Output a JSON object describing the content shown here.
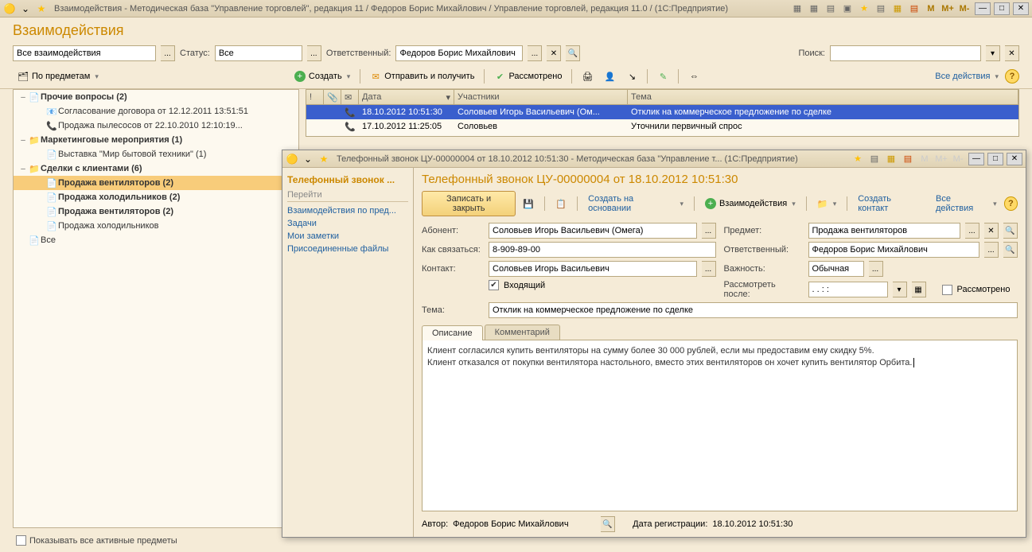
{
  "app": {
    "title": "Взаимодействия - Методическая база \"Управление торговлей\", редакция 11 / Федоров Борис Михайлович / Управление торговлей, редакция 11.0 /  (1С:Предприятие)",
    "m_buttons": [
      "M",
      "M+",
      "M-"
    ]
  },
  "page": {
    "title": "Взаимодействия"
  },
  "filter": {
    "type": "Все взаимодействия",
    "status_label": "Статус:",
    "status": "Все",
    "resp_label": "Ответственный:",
    "resp": "Федоров Борис Михайлович",
    "search_label": "Поиск:"
  },
  "toolbar": {
    "by_subject": "По предметам",
    "create": "Создать",
    "send_receive": "Отправить и получить",
    "reviewed": "Рассмотрено",
    "all_actions": "Все действия"
  },
  "tree": {
    "items": [
      {
        "indent": 0,
        "toggle": "–",
        "icon": "📄",
        "label": "Прочие вопросы (2)",
        "bold": true
      },
      {
        "indent": 1,
        "toggle": "",
        "icon": "📧",
        "label": "Согласование договора от 12.12.2011 13:51:51"
      },
      {
        "indent": 1,
        "toggle": "",
        "icon": "📞",
        "label": "Продажа пылесосов от 22.10.2010 12:10:19..."
      },
      {
        "indent": 0,
        "toggle": "–",
        "icon": "📁",
        "label": "Маркетинговые мероприятия (1)",
        "bold": true
      },
      {
        "indent": 1,
        "toggle": "",
        "icon": "📄",
        "label": "Выставка \"Мир бытовой техники\" (1)"
      },
      {
        "indent": 0,
        "toggle": "–",
        "icon": "📁",
        "label": "Сделки с клиентами (6)",
        "bold": true
      },
      {
        "indent": 1,
        "toggle": "",
        "icon": "📄",
        "label": "Продажа вентиляторов (2)",
        "bold": true,
        "selected": true
      },
      {
        "indent": 1,
        "toggle": "",
        "icon": "📄",
        "label": "Продажа холодильников (2)",
        "bold": true
      },
      {
        "indent": 1,
        "toggle": "",
        "icon": "📄",
        "label": "Продажа вентиляторов (2)",
        "bold": true
      },
      {
        "indent": 1,
        "toggle": "",
        "icon": "📄",
        "label": "Продажа холодильников"
      },
      {
        "indent": 0,
        "toggle": "",
        "icon": "📄",
        "label": "Все"
      }
    ]
  },
  "grid": {
    "cols": [
      "!",
      "📎",
      "✉",
      "Дата",
      "Участники",
      "Тема"
    ],
    "rows": [
      {
        "sel": true,
        "icon": "📞",
        "date": "18.10.2012 10:51:30",
        "part": "Соловьев Игорь Васильевич (Ом...",
        "subj": "Отклик на коммерческое предложение по сделке"
      },
      {
        "sel": false,
        "icon": "📞",
        "date": "17.10.2012 11:25:05",
        "part": "Соловьев",
        "subj": "Уточнили первичный спрос"
      }
    ]
  },
  "bottom_checkbox": "Показывать все активные предметы",
  "modal": {
    "window_title": "Телефонный звонок ЦУ-00000004 от 18.10.2012 10:51:30 - Методическая база \"Управление т...  (1С:Предприятие)",
    "nav": {
      "head": "Телефонный звонок ...",
      "section": "Перейти",
      "links": [
        "Взаимодействия по пред...",
        "Задачи",
        "Мои заметки",
        "Присоединенные файлы"
      ]
    },
    "title": "Телефонный звонок ЦУ-00000004 от 18.10.2012 10:51:30",
    "tb": {
      "save_close": "Записать и закрыть",
      "create_based": "Создать на основании",
      "interactions": "Взаимодействия",
      "create_contact": "Создать контакт",
      "all_actions": "Все действия"
    },
    "form": {
      "abonent_label": "Абонент:",
      "abonent": "Соловьев Игорь Васильевич (Омега)",
      "predmet_label": "Предмет:",
      "predmet": "Продажа вентиляторов",
      "contact_how_label": "Как связаться:",
      "contact_how": "8-909-89-00",
      "resp_label": "Ответственный:",
      "resp": "Федоров Борис Михайлович",
      "contact_label": "Контакт:",
      "contact": "Соловьев Игорь Васильевич",
      "importance_label": "Важность:",
      "importance": "Обычная",
      "incoming_label": "Входящий",
      "review_after_label": "Рассмотреть после:",
      "review_after": "  .  .       :  :",
      "reviewed_label": "Рассмотрено",
      "theme_label": "Тема:",
      "theme": "Отклик на коммерческое предложение по сделке"
    },
    "tabs": {
      "desc": "Описание",
      "comment": "Комментарий"
    },
    "description_line1": "Клиент согласился купить вентиляторы на сумму более 30 000 рублей, если мы предоставим ему скидку 5%.",
    "description_line2": "Клиент отказался от покупки вентилятора настольного, вместо этих вентиляторов он хочет купить вентилятор Орбита.",
    "footer": {
      "author_label": "Автор:",
      "author": "Федоров Борис Михайлович",
      "reg_label": "Дата регистрации:",
      "reg": "18.10.2012 10:51:30"
    }
  }
}
